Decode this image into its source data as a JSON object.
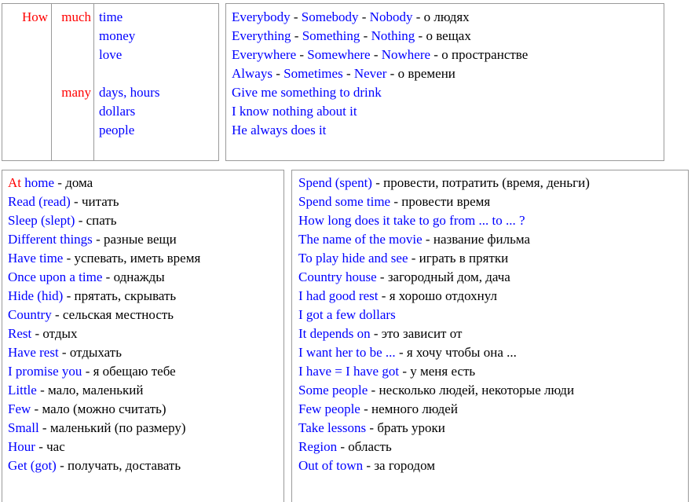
{
  "colors": {
    "english": "#0000ff",
    "highlight": "#ff0000",
    "russian": "#000000",
    "border": "#9a9a9a",
    "background": "#ffffff"
  },
  "quantifier_table": {
    "name": "how-much-how-many",
    "question_word": "How",
    "groups": [
      {
        "quantifier": "much",
        "nouns": [
          "time",
          "money",
          "love"
        ]
      },
      {
        "quantifier": "many",
        "nouns": [
          "days, hours",
          "dollars",
          "people"
        ]
      }
    ]
  },
  "indefinites_table": {
    "name": "indefinite-pronouns",
    "rows": [
      {
        "words": [
          "Everybody",
          "Somebody",
          "Nobody"
        ],
        "note": "о людях"
      },
      {
        "words": [
          "Everything",
          "Something",
          "Nothing"
        ],
        "note": "о вещах"
      },
      {
        "words": [
          "Everywhere",
          "Somewhere",
          "Nowhere"
        ],
        "note": "о пространстве"
      },
      {
        "words": [
          "Always",
          "Sometimes",
          "Never"
        ],
        "note": "о времени"
      }
    ],
    "examples": [
      "Give me something to drink",
      "I know nothing about it",
      "He always does it"
    ],
    "separator": "-"
  },
  "vocab_left": {
    "name": "vocabulary-left",
    "entries": [
      {
        "en": "At home",
        "en_red": "At",
        "ru": "дома"
      },
      {
        "en": "Read (read)",
        "ru": "читать"
      },
      {
        "en": "Sleep (slept)",
        "ru": "спать"
      },
      {
        "en": "Different things",
        "ru": "разные вещи"
      },
      {
        "en": "Have time",
        "ru": "успевать, иметь время"
      },
      {
        "en": "Once upon a time",
        "ru": "однажды"
      },
      {
        "en": "Hide (hid)",
        "ru": "прятать, скрывать"
      },
      {
        "en": "Country",
        "ru": "сельская местность"
      },
      {
        "en": "Rest",
        "ru": "отдых"
      },
      {
        "en": "Have rest",
        "ru": "отдыхать"
      },
      {
        "en": "I promise you",
        "ru": "я обещаю тебе"
      },
      {
        "en": "Little",
        "ru": "мало, маленький"
      },
      {
        "en": "Few",
        "ru": "мало (можно считать)"
      },
      {
        "en": "Small",
        "ru": "маленький (по размеру)"
      },
      {
        "en": "Hour",
        "ru": "час"
      },
      {
        "en": "Get (got)",
        "ru": "получать, доставать"
      }
    ]
  },
  "vocab_right": {
    "name": "vocabulary-right",
    "entries": [
      {
        "en": "Spend (spent)",
        "ru": "провести, потратить (время, деньги)"
      },
      {
        "en": "Spend some time",
        "ru": "провести время"
      },
      {
        "en": "How long does it take to go from ... to ... ?",
        "ru": ""
      },
      {
        "en": "The name of the movie",
        "ru": "название фильма"
      },
      {
        "en": "To play hide and see",
        "ru": "играть в прятки"
      },
      {
        "en": "Country house",
        "ru": "загородный дом, дача"
      },
      {
        "en": "I had good rest",
        "ru": "я хорошо отдохнул"
      },
      {
        "en": "I got a few dollars",
        "ru": ""
      },
      {
        "en": "It depends on",
        "ru": "это зависит от"
      },
      {
        "en": "I want her to be ...",
        "ru": "я хочу чтобы она ..."
      },
      {
        "en": "I have = I have got",
        "ru": "у меня есть"
      },
      {
        "en": "Some people",
        "ru": "несколько людей, некоторые люди"
      },
      {
        "en": "Few people",
        "ru": "немного людей"
      },
      {
        "en": "Take lessons",
        "ru": "брать уроки"
      },
      {
        "en": "Region",
        "ru": "область"
      },
      {
        "en": "Out of town",
        "ru": "за городом"
      }
    ]
  }
}
